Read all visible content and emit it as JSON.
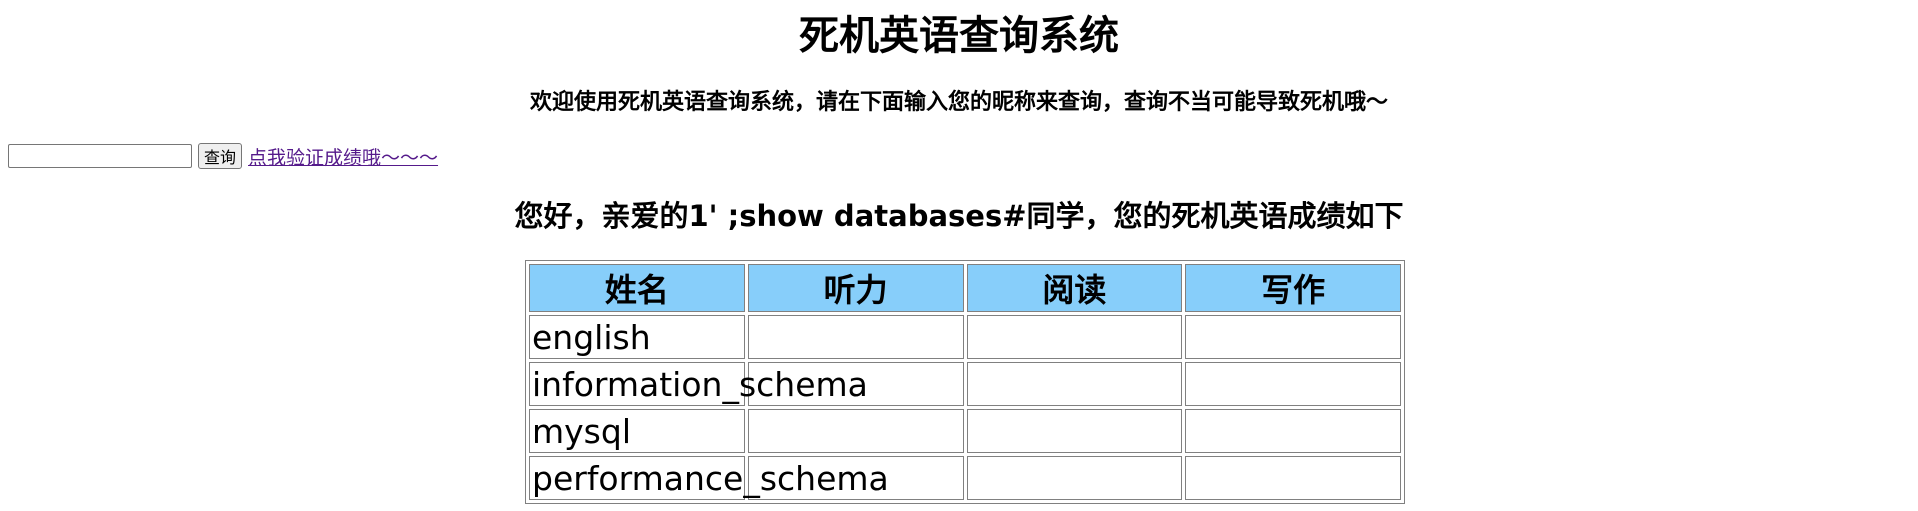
{
  "page": {
    "title": "死机英语查询系统",
    "subtitle": "欢迎使用死机英语查询系统，请在下面输入您的昵称来查询，查询不当可能导致死机哦～"
  },
  "form": {
    "input_value": "",
    "query_button": "查询",
    "verify_link": "点我验证成绩哦～～～"
  },
  "result": {
    "greeting": "您好，亲爱的1' ;show databases#同学，您的死机英语成绩如下",
    "table": {
      "headers": [
        "姓名",
        "听力",
        "阅读",
        "写作"
      ],
      "rows": [
        [
          "english",
          "",
          "",
          ""
        ],
        [
          "information_schema",
          "",
          "",
          ""
        ],
        [
          "mysql",
          "",
          "",
          ""
        ],
        [
          "performance_schema",
          "",
          "",
          ""
        ]
      ]
    }
  },
  "colors": {
    "header_bg": "#87cefa",
    "link": "#551a8b"
  }
}
